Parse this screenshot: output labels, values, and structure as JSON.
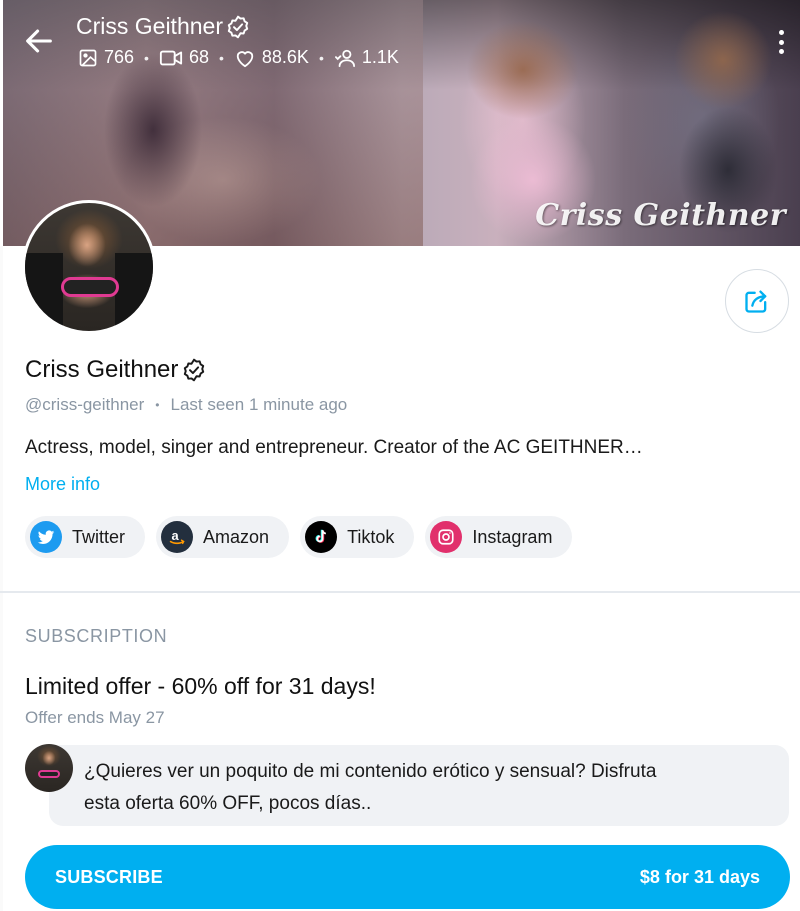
{
  "header": {
    "name": "Criss Geithner",
    "watermark": "Criss Geithner",
    "stats": {
      "photos": "766",
      "videos": "68",
      "likes": "88.6K",
      "fans": "1.1K"
    }
  },
  "profile": {
    "name": "Criss Geithner",
    "handle": "@criss-geithner",
    "last_seen": "Last seen 1 minute ago",
    "bio": "Actress, model, singer and entrepreneur. Creator of the AC GEITHNER…",
    "more_info": "More info"
  },
  "socials": [
    {
      "label": "Twitter",
      "icon": "twitter-icon",
      "color": "#1d9bf0"
    },
    {
      "label": "Amazon",
      "icon": "amazon-icon",
      "color": "#232f3e"
    },
    {
      "label": "Tiktok",
      "icon": "tiktok-icon",
      "color": "#000000"
    },
    {
      "label": "Instagram",
      "icon": "instagram-icon",
      "color": "#e1306c"
    }
  ],
  "subscription": {
    "heading": "SUBSCRIPTION",
    "offer_title": "Limited offer - 60% off for 31 days!",
    "offer_ends": "Offer ends May 27",
    "message_line1": "¿Quieres ver un poquito de mi contenido erótico y sensual? Disfruta",
    "message_line2": "esta oferta 60% OFF, pocos días..",
    "button_label": "SUBSCRIBE",
    "button_price": "$8 for 31 days"
  },
  "colors": {
    "accent": "#00aff0",
    "muted_text": "#8a96a3",
    "chip_bg": "#f0f2f5"
  }
}
